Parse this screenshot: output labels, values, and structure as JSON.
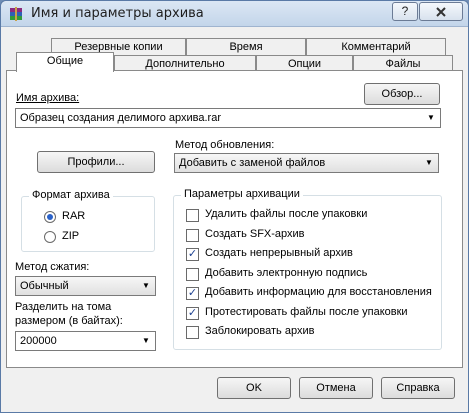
{
  "window": {
    "title": "Имя и параметры архива",
    "help_label": "?",
    "close_label": "X"
  },
  "tabs_back": [
    "Резервные копии",
    "Время",
    "Комментарий"
  ],
  "tabs_front": [
    "Общие",
    "Дополнительно",
    "Опции",
    "Файлы"
  ],
  "active_tab": "Общие",
  "archive_name": {
    "label": "Имя архива:",
    "browse_label": "Обзор...",
    "value": "Образец создания делимого архива.rar"
  },
  "profiles_label": "Профили...",
  "update_method": {
    "label": "Метод обновления:",
    "value": "Добавить с заменой файлов"
  },
  "archive_format": {
    "title": "Формат архива",
    "options": [
      {
        "label": "RAR",
        "selected": true
      },
      {
        "label": "ZIP",
        "selected": false
      }
    ]
  },
  "compression": {
    "label": "Метод сжатия:",
    "value": "Обычный"
  },
  "split": {
    "label_line1": "Разделить на тома",
    "label_line2": "размером (в байтах):",
    "value": "200000"
  },
  "archive_options": {
    "title": "Параметры архивации",
    "items": [
      {
        "label": "Удалить файлы после упаковки",
        "checked": false
      },
      {
        "label": "Создать SFX-архив",
        "checked": false
      },
      {
        "label": "Создать непрерывный архив",
        "checked": true
      },
      {
        "label": "Добавить электронную подпись",
        "checked": false
      },
      {
        "label": "Добавить информацию для восстановления",
        "checked": true
      },
      {
        "label": "Протестировать файлы после упаковки",
        "checked": true
      },
      {
        "label": "Заблокировать архив",
        "checked": false
      }
    ]
  },
  "buttons": {
    "ok": "OK",
    "cancel": "Отмена",
    "help": "Справка"
  },
  "icons": {
    "arrow": "▼",
    "check": "✓"
  }
}
